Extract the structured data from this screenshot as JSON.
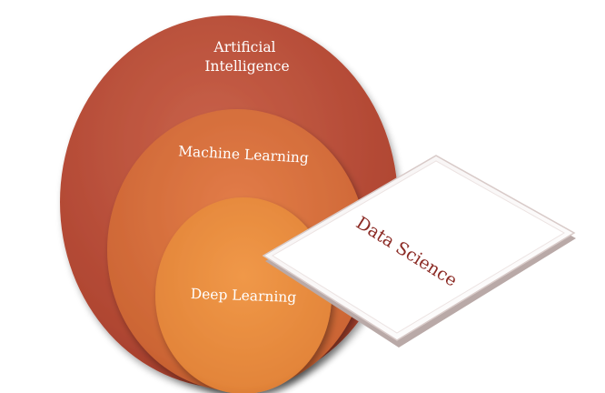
{
  "diagram": {
    "layers": [
      {
        "id": "ai",
        "label_lines": [
          "Artificial",
          "Intelligence"
        ],
        "color": "#b54b36"
      },
      {
        "id": "ml",
        "label_lines": [
          "Machine Learning"
        ],
        "color": "#d06a37"
      },
      {
        "id": "dl",
        "label_lines": [
          "Deep Learning"
        ],
        "color": "#e58a3c"
      }
    ],
    "overlay": {
      "label": "Data Science",
      "text_color": "#8b2a24"
    }
  }
}
